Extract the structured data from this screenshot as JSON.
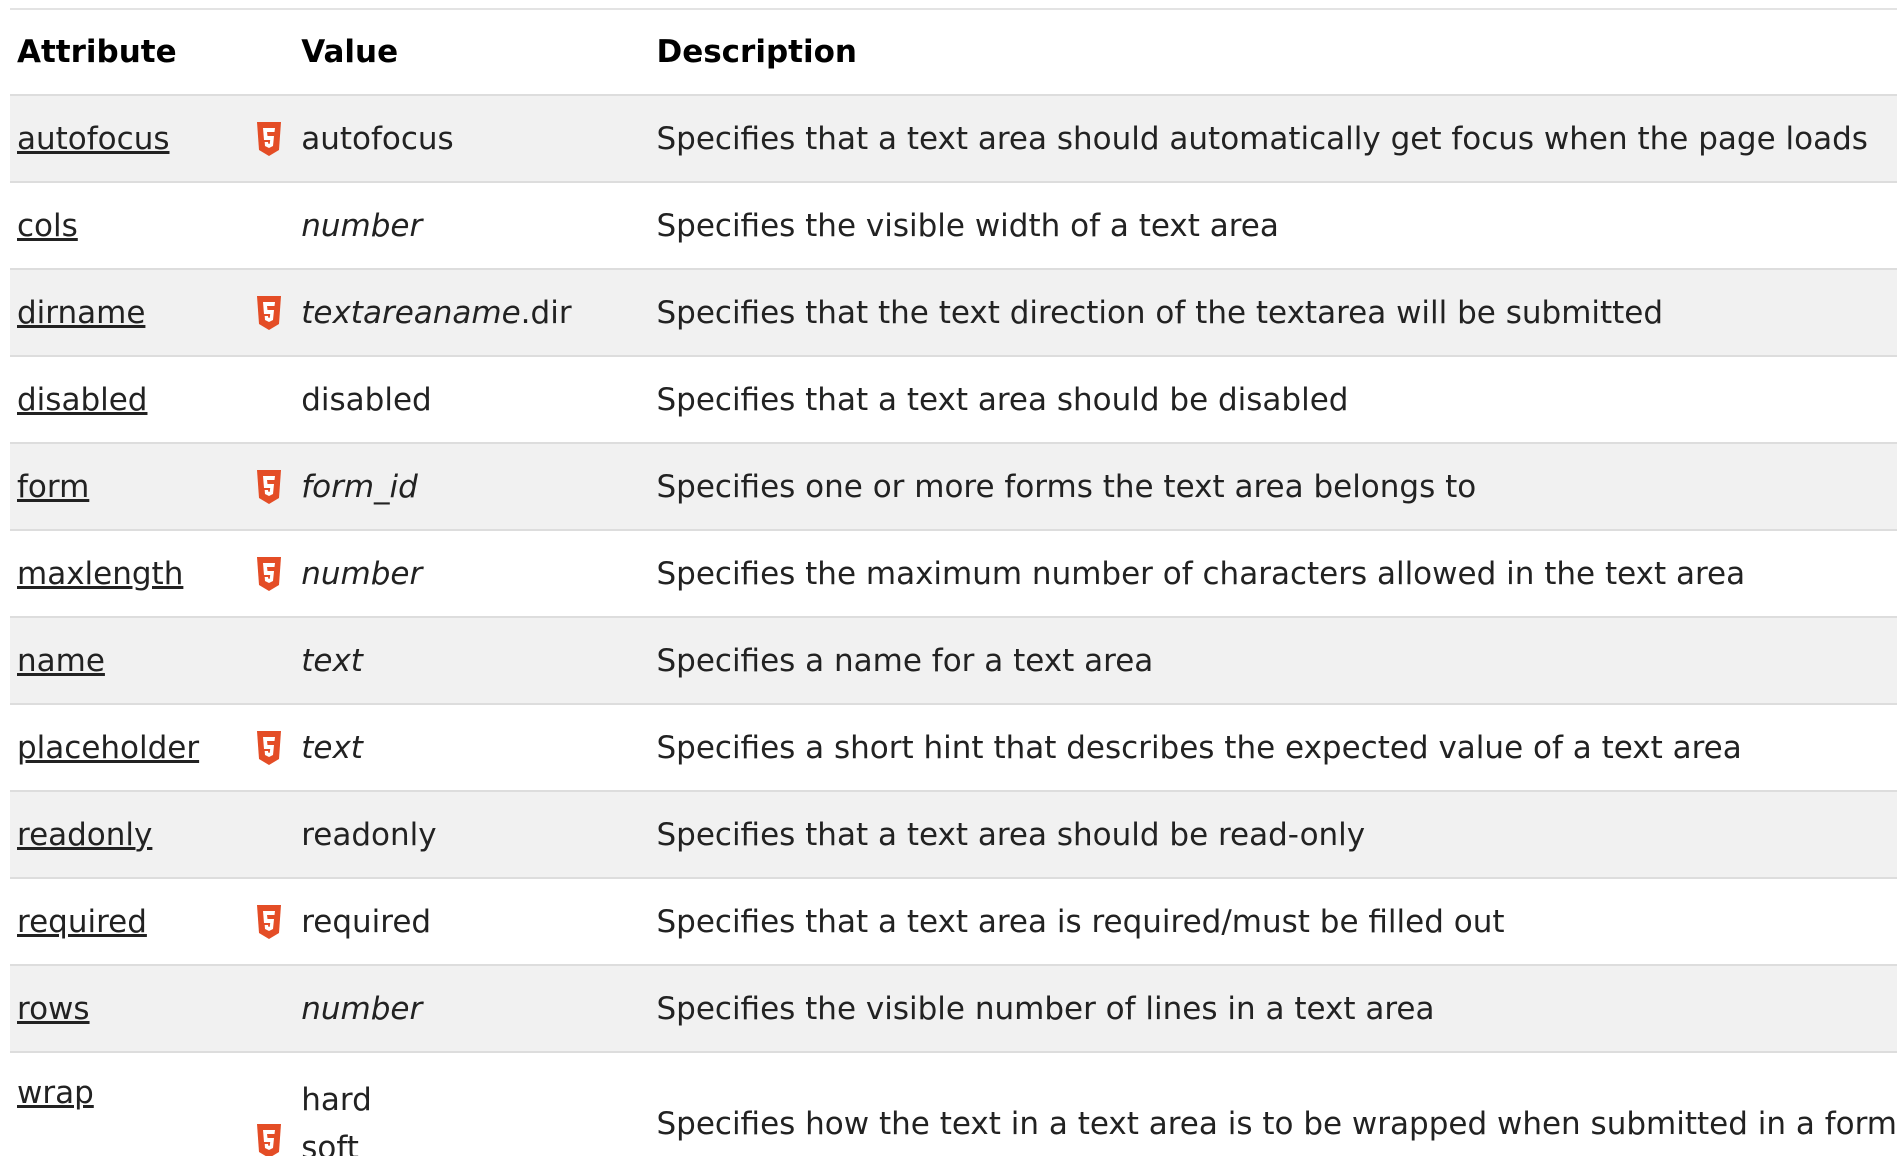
{
  "header": {
    "attribute": "Attribute",
    "value": "Value",
    "description": "Description"
  },
  "badge_icon": "html5-icon",
  "accent_colors": {
    "html5_badge": "#e44d26",
    "row_stripe": "#f1f1f1"
  },
  "rows": [
    {
      "attribute": "autofocus",
      "html5": true,
      "value": "autofocus",
      "value_italic": false,
      "description": "Specifies that a text area should automatically get focus when the page loads"
    },
    {
      "attribute": "cols",
      "html5": false,
      "value": "number",
      "value_italic": true,
      "description": "Specifies the visible width of a text area"
    },
    {
      "attribute": "dirname",
      "html5": true,
      "value_italic_part": "textareaname",
      "value_suffix": ".dir",
      "description": "Specifies that the text direction of the textarea will be submitted"
    },
    {
      "attribute": "disabled",
      "html5": false,
      "value": "disabled",
      "value_italic": false,
      "description": "Specifies that a text area should be disabled"
    },
    {
      "attribute": "form",
      "html5": true,
      "value": "form_id",
      "value_italic": true,
      "description": "Specifies one or more forms the text area belongs to"
    },
    {
      "attribute": "maxlength",
      "html5": true,
      "value": "number",
      "value_italic": true,
      "description": "Specifies the maximum number of characters allowed in the text area"
    },
    {
      "attribute": "name",
      "html5": false,
      "value": "text",
      "value_italic": true,
      "description": "Specifies a name for a text area"
    },
    {
      "attribute": "placeholder",
      "html5": true,
      "value": "text",
      "value_italic": true,
      "description": "Specifies a short hint that describes the expected value of a text area"
    },
    {
      "attribute": "readonly",
      "html5": false,
      "value": "readonly",
      "value_italic": false,
      "description": "Specifies that a text area should be read-only"
    },
    {
      "attribute": "required",
      "html5": true,
      "value": "required",
      "value_italic": false,
      "description": "Specifies that a text area is required/must be filled out"
    },
    {
      "attribute": "rows",
      "html5": false,
      "value": "number",
      "value_italic": true,
      "description": "Specifies the visible number of lines in a text area"
    },
    {
      "attribute": "wrap",
      "html5": true,
      "values": [
        "hard",
        "soft"
      ],
      "value_italic": false,
      "description": "Specifies how the text in a text area is to be wrapped when submitted in a form"
    }
  ]
}
